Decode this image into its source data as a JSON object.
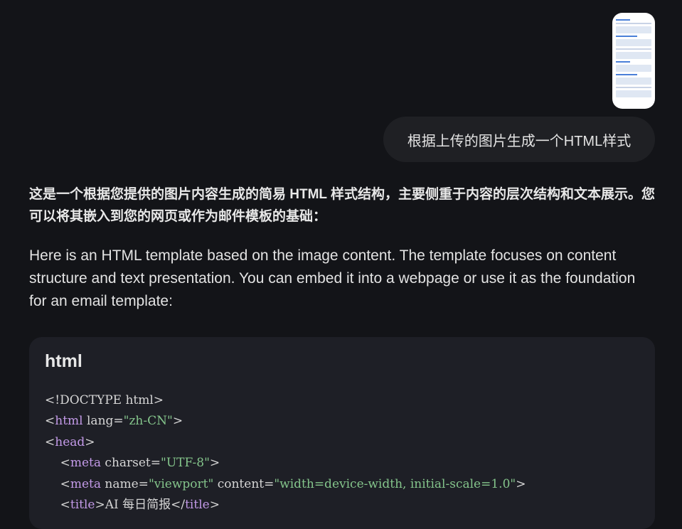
{
  "user_message": {
    "text": "根据上传的图片生成一个HTML样式"
  },
  "response": {
    "zh_part1": "这是一个根据您提供的图片内容生成的简易 ",
    "zh_bold": "HTML 样式",
    "zh_part2": "结构，主要侧重于内容的层次结构和文本展示。您可以将其嵌入到您的网页或作为邮件模板的基础：",
    "en": "Here is an HTML template based on the image content. The template focuses on content structure and text presentation. You can embed it into a webpage or use it as the foundation for an email template:"
  },
  "code_block": {
    "language": "html",
    "line1": "<!DOCTYPE html>",
    "line2_lt": "<",
    "line2_tag": "html",
    "line2_attr": " lang=",
    "line2_val": "\"zh-CN\"",
    "line2_gt": ">",
    "line3_lt": "<",
    "line3_tag": "head",
    "line3_gt": ">",
    "line4_lt": "    <",
    "line4_tag": "meta",
    "line4_attr": " charset=",
    "line4_val": "\"UTF-8\"",
    "line4_gt": ">",
    "line5_lt": "    <",
    "line5_tag": "meta",
    "line5_attr1": " name=",
    "line5_val1": "\"viewport\"",
    "line5_attr2": " content=",
    "line5_val2": "\"width=device-width, initial-scale=1.0\"",
    "line5_gt": ">",
    "line6_lt": "    <",
    "line6_tag": "title",
    "line6_text": ">AI 每日简报</",
    "line6_tag2": "title",
    "line6_gt": ">"
  },
  "colors": {
    "background": "#131418",
    "bubble": "#1f2024",
    "code_bg": "#1e1f26",
    "tag": "#c39ae8",
    "string": "#84c48b"
  },
  "icons": [
    "uploaded-image-thumbnail"
  ]
}
